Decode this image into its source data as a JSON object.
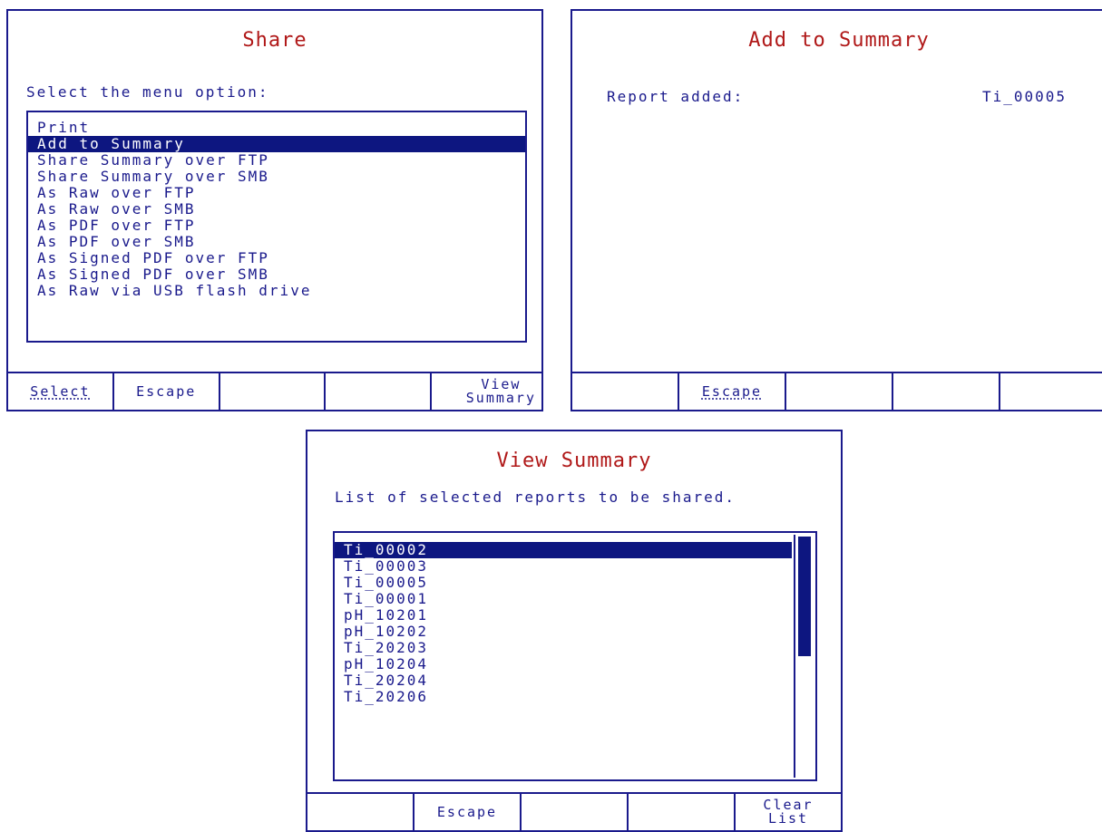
{
  "share": {
    "title": "Share",
    "prompt": "Select the menu option:",
    "menu": [
      {
        "label": "Print",
        "selected": false
      },
      {
        "label": "Add to Summary",
        "selected": true
      },
      {
        "label": "Share Summary over FTP",
        "selected": false
      },
      {
        "label": "Share Summary over SMB",
        "selected": false
      },
      {
        "label": "As Raw over FTP",
        "selected": false
      },
      {
        "label": "As Raw over SMB",
        "selected": false
      },
      {
        "label": "As PDF over FTP",
        "selected": false
      },
      {
        "label": "As PDF over SMB",
        "selected": false
      },
      {
        "label": "As Signed PDF over FTP",
        "selected": false
      },
      {
        "label": "As Signed PDF over SMB",
        "selected": false
      },
      {
        "label": "As Raw via USB flash drive",
        "selected": false
      }
    ],
    "softkeys": [
      "Select",
      "Escape",
      "",
      "",
      "View\nSummary"
    ]
  },
  "add_summary": {
    "title": "Add to Summary",
    "label": "Report added:",
    "value": "Ti_00005",
    "softkeys": [
      "",
      "Escape",
      "",
      "",
      ""
    ]
  },
  "view_summary": {
    "title": "View Summary",
    "description": "List of selected reports to be shared.",
    "reports": [
      {
        "label": "Ti_00002",
        "selected": true
      },
      {
        "label": "Ti_00003",
        "selected": false
      },
      {
        "label": "Ti_00005",
        "selected": false
      },
      {
        "label": "Ti_00001",
        "selected": false
      },
      {
        "label": "pH_10201",
        "selected": false
      },
      {
        "label": "pH_10202",
        "selected": false
      },
      {
        "label": "Ti_20203",
        "selected": false
      },
      {
        "label": "pH_10204",
        "selected": false
      },
      {
        "label": "Ti_20204",
        "selected": false
      },
      {
        "label": "Ti_20206",
        "selected": false
      }
    ],
    "softkeys": [
      "",
      "Escape",
      "",
      "",
      "Clear\nList"
    ]
  },
  "colors": {
    "frame": "#1a1a8c",
    "title": "#b01818",
    "highlight": "#0d1680"
  }
}
